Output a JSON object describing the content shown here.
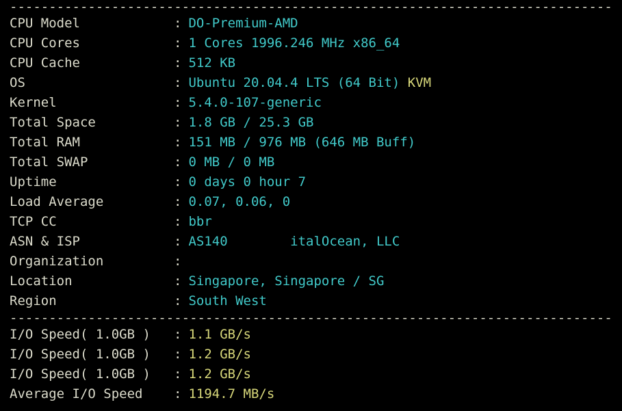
{
  "sep": ":",
  "hr": "-----------------------------------------------------------------------------",
  "sys": {
    "cpu_model": {
      "label": "CPU Model",
      "value": "DO-Premium-AMD"
    },
    "cpu_cores": {
      "label": "CPU Cores",
      "value": "1 Cores 1996.246 MHz x86_64"
    },
    "cpu_cache": {
      "label": "CPU Cache",
      "value": "512 KB"
    },
    "os": {
      "label": "OS",
      "value": "Ubuntu 20.04.4 LTS (64 Bit)",
      "extra": "KVM"
    },
    "kernel": {
      "label": "Kernel",
      "value": "5.4.0-107-generic"
    },
    "total_space": {
      "label": "Total Space",
      "value": "1.8 GB / 25.3 GB"
    },
    "total_ram": {
      "label": "Total RAM",
      "value": "151 MB / 976 MB (646 MB Buff)"
    },
    "total_swap": {
      "label": "Total SWAP",
      "value": "0 MB / 0 MB"
    },
    "uptime": {
      "label": "Uptime",
      "value": "0 days 0 hour 7"
    },
    "load_avg": {
      "label": "Load Average",
      "value": "0.07, 0.06, 0"
    },
    "tcp_cc": {
      "label": "TCP CC",
      "value": "bbr"
    },
    "asn_isp": {
      "label": "ASN & ISP",
      "value": "AS140        italOcean, LLC"
    },
    "organization": {
      "label": "Organization",
      "value": ""
    },
    "location": {
      "label": "Location",
      "value": "Singapore, Singapore / SG"
    },
    "region": {
      "label": "Region",
      "value": "South West"
    }
  },
  "io": {
    "r1": {
      "label": "I/O Speed( 1.0GB )",
      "value": "1.1 GB/s"
    },
    "r2": {
      "label": "I/O Speed( 1.0GB )",
      "value": "1.2 GB/s"
    },
    "r3": {
      "label": "I/O Speed( 1.0GB )",
      "value": "1.2 GB/s"
    },
    "avg": {
      "label": "Average I/O Speed",
      "value": "1194.7 MB/s"
    }
  }
}
